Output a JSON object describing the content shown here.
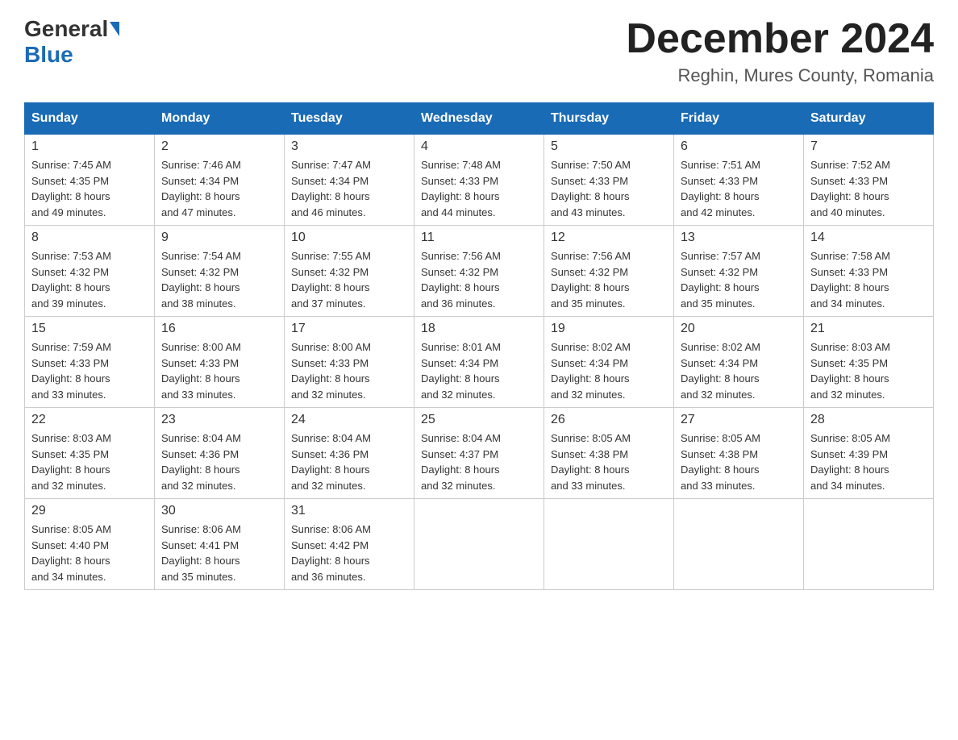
{
  "logo": {
    "general": "General",
    "blue": "Blue"
  },
  "title": "December 2024",
  "location": "Reghin, Mures County, Romania",
  "days_of_week": [
    "Sunday",
    "Monday",
    "Tuesday",
    "Wednesday",
    "Thursday",
    "Friday",
    "Saturday"
  ],
  "weeks": [
    [
      {
        "day": "1",
        "sunrise": "7:45 AM",
        "sunset": "4:35 PM",
        "daylight": "8 hours and 49 minutes."
      },
      {
        "day": "2",
        "sunrise": "7:46 AM",
        "sunset": "4:34 PM",
        "daylight": "8 hours and 47 minutes."
      },
      {
        "day": "3",
        "sunrise": "7:47 AM",
        "sunset": "4:34 PM",
        "daylight": "8 hours and 46 minutes."
      },
      {
        "day": "4",
        "sunrise": "7:48 AM",
        "sunset": "4:33 PM",
        "daylight": "8 hours and 44 minutes."
      },
      {
        "day": "5",
        "sunrise": "7:50 AM",
        "sunset": "4:33 PM",
        "daylight": "8 hours and 43 minutes."
      },
      {
        "day": "6",
        "sunrise": "7:51 AM",
        "sunset": "4:33 PM",
        "daylight": "8 hours and 42 minutes."
      },
      {
        "day": "7",
        "sunrise": "7:52 AM",
        "sunset": "4:33 PM",
        "daylight": "8 hours and 40 minutes."
      }
    ],
    [
      {
        "day": "8",
        "sunrise": "7:53 AM",
        "sunset": "4:32 PM",
        "daylight": "8 hours and 39 minutes."
      },
      {
        "day": "9",
        "sunrise": "7:54 AM",
        "sunset": "4:32 PM",
        "daylight": "8 hours and 38 minutes."
      },
      {
        "day": "10",
        "sunrise": "7:55 AM",
        "sunset": "4:32 PM",
        "daylight": "8 hours and 37 minutes."
      },
      {
        "day": "11",
        "sunrise": "7:56 AM",
        "sunset": "4:32 PM",
        "daylight": "8 hours and 36 minutes."
      },
      {
        "day": "12",
        "sunrise": "7:56 AM",
        "sunset": "4:32 PM",
        "daylight": "8 hours and 35 minutes."
      },
      {
        "day": "13",
        "sunrise": "7:57 AM",
        "sunset": "4:32 PM",
        "daylight": "8 hours and 35 minutes."
      },
      {
        "day": "14",
        "sunrise": "7:58 AM",
        "sunset": "4:33 PM",
        "daylight": "8 hours and 34 minutes."
      }
    ],
    [
      {
        "day": "15",
        "sunrise": "7:59 AM",
        "sunset": "4:33 PM",
        "daylight": "8 hours and 33 minutes."
      },
      {
        "day": "16",
        "sunrise": "8:00 AM",
        "sunset": "4:33 PM",
        "daylight": "8 hours and 33 minutes."
      },
      {
        "day": "17",
        "sunrise": "8:00 AM",
        "sunset": "4:33 PM",
        "daylight": "8 hours and 32 minutes."
      },
      {
        "day": "18",
        "sunrise": "8:01 AM",
        "sunset": "4:34 PM",
        "daylight": "8 hours and 32 minutes."
      },
      {
        "day": "19",
        "sunrise": "8:02 AM",
        "sunset": "4:34 PM",
        "daylight": "8 hours and 32 minutes."
      },
      {
        "day": "20",
        "sunrise": "8:02 AM",
        "sunset": "4:34 PM",
        "daylight": "8 hours and 32 minutes."
      },
      {
        "day": "21",
        "sunrise": "8:03 AM",
        "sunset": "4:35 PM",
        "daylight": "8 hours and 32 minutes."
      }
    ],
    [
      {
        "day": "22",
        "sunrise": "8:03 AM",
        "sunset": "4:35 PM",
        "daylight": "8 hours and 32 minutes."
      },
      {
        "day": "23",
        "sunrise": "8:04 AM",
        "sunset": "4:36 PM",
        "daylight": "8 hours and 32 minutes."
      },
      {
        "day": "24",
        "sunrise": "8:04 AM",
        "sunset": "4:36 PM",
        "daylight": "8 hours and 32 minutes."
      },
      {
        "day": "25",
        "sunrise": "8:04 AM",
        "sunset": "4:37 PM",
        "daylight": "8 hours and 32 minutes."
      },
      {
        "day": "26",
        "sunrise": "8:05 AM",
        "sunset": "4:38 PM",
        "daylight": "8 hours and 33 minutes."
      },
      {
        "day": "27",
        "sunrise": "8:05 AM",
        "sunset": "4:38 PM",
        "daylight": "8 hours and 33 minutes."
      },
      {
        "day": "28",
        "sunrise": "8:05 AM",
        "sunset": "4:39 PM",
        "daylight": "8 hours and 34 minutes."
      }
    ],
    [
      {
        "day": "29",
        "sunrise": "8:05 AM",
        "sunset": "4:40 PM",
        "daylight": "8 hours and 34 minutes."
      },
      {
        "day": "30",
        "sunrise": "8:06 AM",
        "sunset": "4:41 PM",
        "daylight": "8 hours and 35 minutes."
      },
      {
        "day": "31",
        "sunrise": "8:06 AM",
        "sunset": "4:42 PM",
        "daylight": "8 hours and 36 minutes."
      },
      null,
      null,
      null,
      null
    ]
  ],
  "labels": {
    "sunrise": "Sunrise:",
    "sunset": "Sunset:",
    "daylight": "Daylight:"
  }
}
